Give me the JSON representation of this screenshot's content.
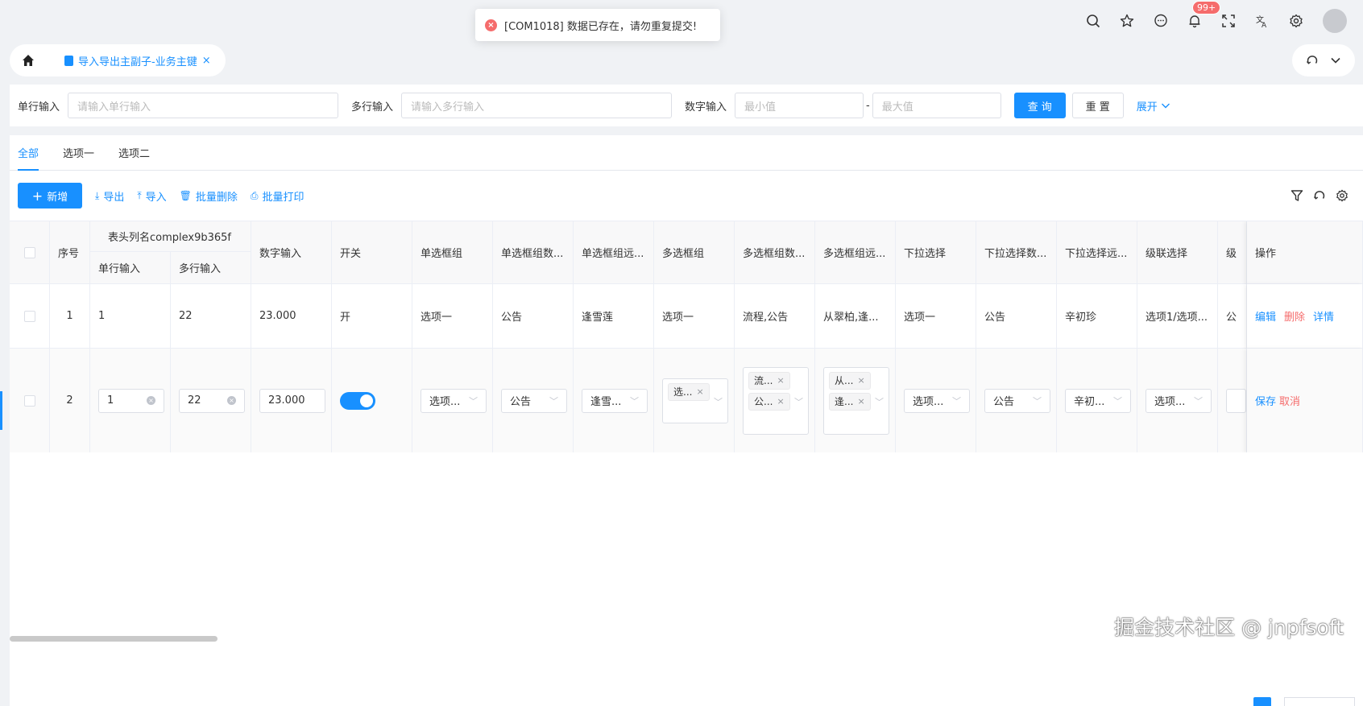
{
  "toast": {
    "message": "[COM1018] 数据已存在，请勿重复提交!",
    "icon": "error-icon"
  },
  "topbar": {
    "notification_badge": "99+",
    "icons": [
      "search-icon",
      "star-icon",
      "message-icon",
      "bell-icon",
      "fullscreen-icon",
      "translate-icon",
      "settings-icon"
    ]
  },
  "tabs": {
    "active_tab_label": "导入导出主副子-业务主键",
    "close_label": "×"
  },
  "search": {
    "single_label": "单行输入",
    "single_placeholder": "请输入单行输入",
    "multi_label": "多行输入",
    "multi_placeholder": "请输入多行输入",
    "number_label": "数字输入",
    "min_placeholder": "最小值",
    "separator": "-",
    "max_placeholder": "最大值",
    "query_label": "查 询",
    "reset_label": "重 置",
    "expand_label": "展开"
  },
  "subtabs": [
    "全部",
    "选项一",
    "选项二"
  ],
  "toolbar": {
    "add_label": "新增",
    "export_label": "导出",
    "import_label": "导入",
    "batch_delete_label": "批量删除",
    "batch_print_label": "批量打印"
  },
  "table": {
    "group_header": "表头列名complex9b365f",
    "headers": {
      "index": "序号",
      "single": "单行输入",
      "multi": "多行输入",
      "number": "数字输入",
      "switch": "开关",
      "radio": "单选框组",
      "radio_data": "单选框组数...",
      "radio_remote": "单选框组远...",
      "checkbox": "多选框组",
      "checkbox_data": "多选框组数...",
      "checkbox_remote": "多选框组远...",
      "select": "下拉选择",
      "select_data": "下拉选择数...",
      "select_remote": "下拉选择远...",
      "cascader": "级联选择",
      "cascader2": "级",
      "ops": "操作"
    },
    "row1": {
      "index": "1",
      "single": "1",
      "multi": "22",
      "number": "23.000",
      "switch": "开",
      "radio": "选项一",
      "radio_data": "公告",
      "radio_remote": "逢雪莲",
      "checkbox": "选项一",
      "checkbox_data": "流程,公告",
      "checkbox_remote": "从翠柏,逢...",
      "select": "选项一",
      "select_data": "公告",
      "select_remote": "辛初珍",
      "cascader": "选项1/选项...",
      "cascader2": "公",
      "op_edit": "编辑",
      "op_delete": "删除",
      "op_detail": "详情"
    },
    "row2": {
      "index": "2",
      "single": "1",
      "multi": "22",
      "number": "23.000",
      "radio": "选项...",
      "radio_data": "公告",
      "radio_remote": "逢雪...",
      "checkbox_tag": "选...",
      "checkbox_data_tags": [
        "流...",
        "公..."
      ],
      "checkbox_remote_tags": [
        "从...",
        "逢..."
      ],
      "select": "选项...",
      "select_data": "公告",
      "select_remote": "辛初...",
      "cascader": "选项...",
      "op_save": "保存",
      "op_cancel": "取消"
    }
  },
  "watermark": "掘金技术社区 @ jnpfsoft"
}
